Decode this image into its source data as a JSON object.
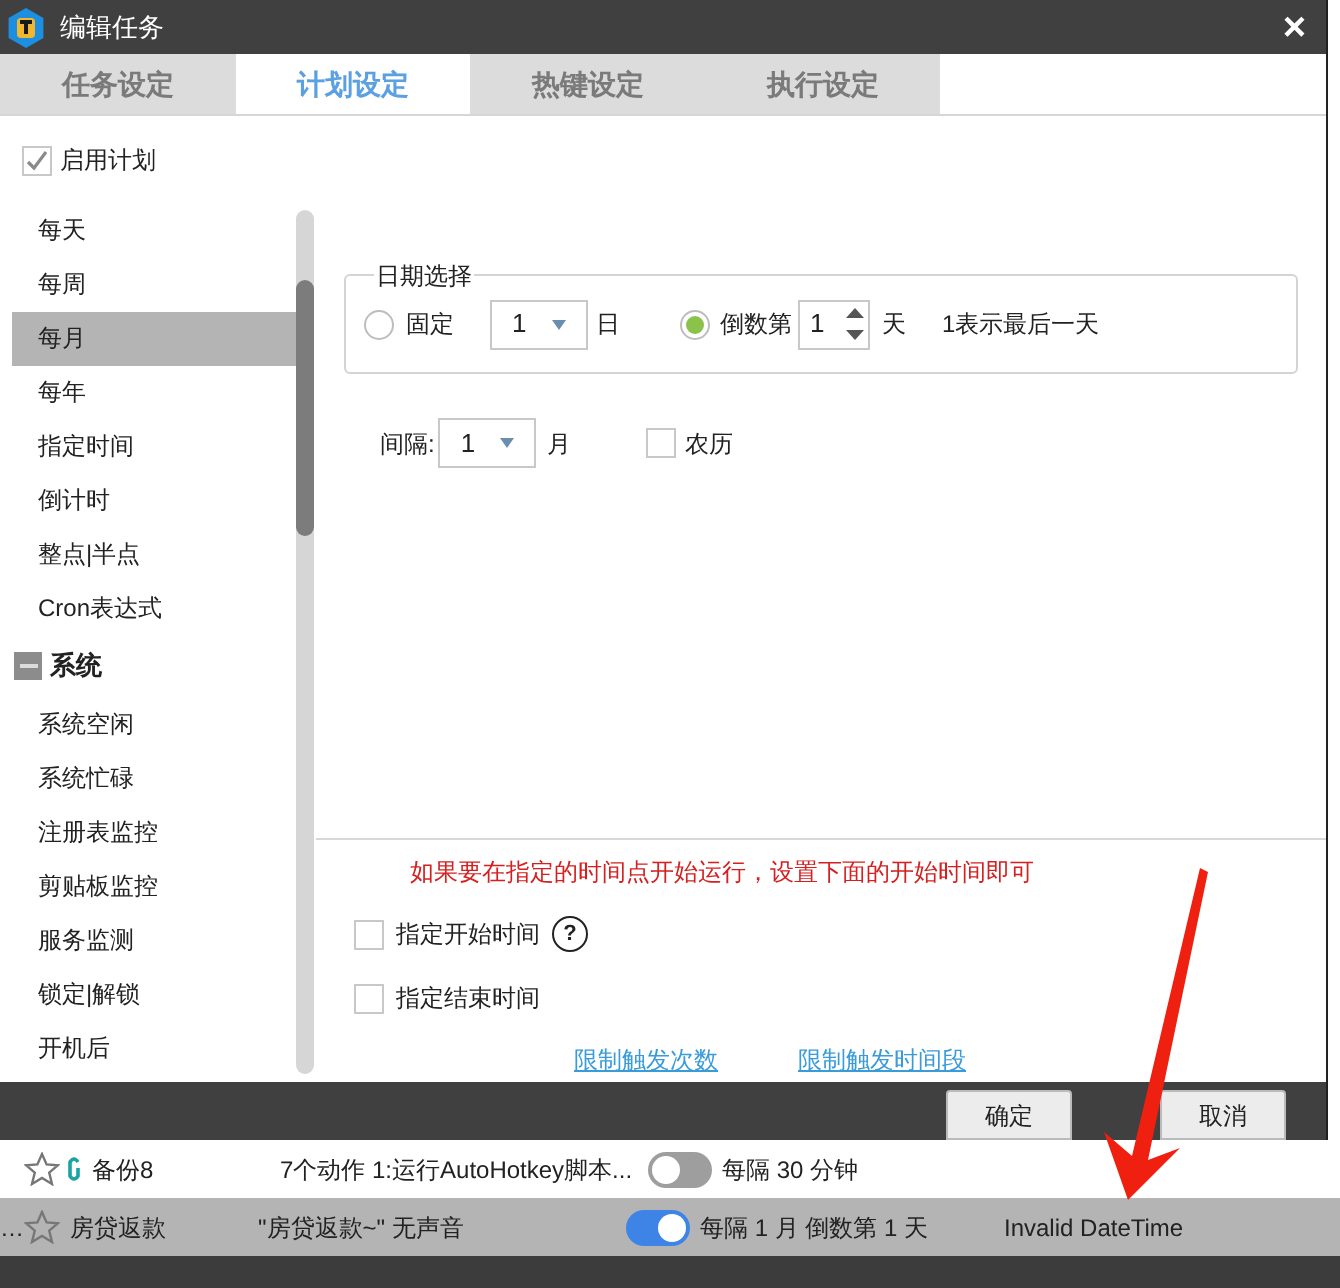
{
  "window": {
    "title": "编辑任务",
    "close": "×"
  },
  "tabs": [
    {
      "label": "任务设定",
      "selected": false
    },
    {
      "label": "计划设定",
      "selected": true
    },
    {
      "label": "热键设定",
      "selected": false
    },
    {
      "label": "执行设定",
      "selected": false
    }
  ],
  "sidebar": {
    "enable": {
      "label": "启用计划",
      "checked": true
    },
    "items": [
      {
        "label": "每天",
        "selected": false
      },
      {
        "label": "每周",
        "selected": false
      },
      {
        "label": "每月",
        "selected": true
      },
      {
        "label": "每年",
        "selected": false
      },
      {
        "label": "指定时间",
        "selected": false
      },
      {
        "label": "倒计时",
        "selected": false
      },
      {
        "label": "整点|半点",
        "selected": false
      },
      {
        "label": "Cron表达式",
        "selected": false
      }
    ],
    "group": {
      "label": "系统",
      "expanded": true,
      "children": [
        {
          "label": "系统空闲",
          "selected": false
        },
        {
          "label": "系统忙碌",
          "selected": false
        },
        {
          "label": "注册表监控",
          "selected": false
        },
        {
          "label": "剪贴板监控",
          "selected": false
        },
        {
          "label": "服务监测",
          "selected": false
        },
        {
          "label": "锁定|解锁",
          "selected": false
        },
        {
          "label": "开机后",
          "selected": false
        }
      ]
    }
  },
  "date_choice": {
    "legend": "日期选择",
    "fixed": {
      "label": "固定",
      "selected": false,
      "value": "1",
      "unit": "日"
    },
    "countdown": {
      "label": "倒数第",
      "selected": true,
      "value": "1",
      "unit": "天",
      "hint": "1表示最后一天"
    }
  },
  "interval": {
    "label": "间隔:",
    "value": "1",
    "unit": "月"
  },
  "lunar": {
    "label": "农历",
    "checked": false
  },
  "notice": "如果要在指定的时间点开始运行，设置下面的开始时间即可",
  "start_time": {
    "label": "指定开始时间",
    "checked": false,
    "help": "?"
  },
  "end_time": {
    "label": "指定结束时间",
    "checked": false
  },
  "links": [
    "限制触发次数",
    "限制触发时间段"
  ],
  "buttons": [
    "确定",
    "取消"
  ],
  "background_rows": [
    {
      "lead": "",
      "name": "备份8",
      "action": "7个动作 1:运行AutoHotkey脚本...",
      "on": false,
      "schedule": "每隔 30 分钟",
      "next": "",
      "selected": false
    },
    {
      "lead": "…",
      "name": "房贷返款",
      "action": "\"房贷返款~\" 无声音",
      "on": true,
      "schedule": "每隔 1 月 倒数第 1 天",
      "next": "Invalid DateTime",
      "selected": true
    }
  ]
}
